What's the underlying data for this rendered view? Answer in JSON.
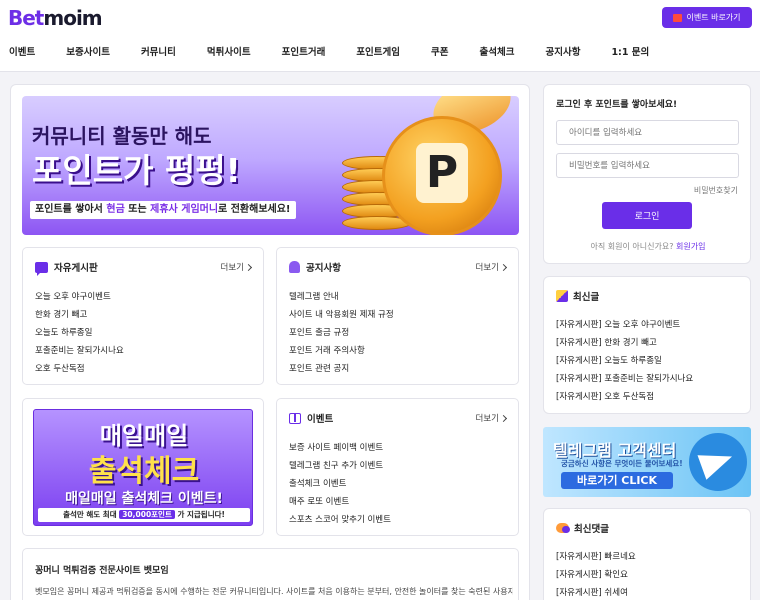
{
  "header": {
    "logo_a": "Bet",
    "logo_b": "moim",
    "event_button": "이벤트 바로가기"
  },
  "nav": [
    "이벤트",
    "보증사이트",
    "커뮤니티",
    "먹튀사이트",
    "포인트거래",
    "포인트게임",
    "쿠폰",
    "출석체크",
    "공지사항",
    "1:1 문의"
  ],
  "banner": {
    "line1": "커뮤니티 활동만 해도",
    "line2": "포인트가 펑펑!",
    "sub_pre": "포인트를 쌓아서 ",
    "sub_hl1": "현금",
    "sub_mid": " 또는 ",
    "sub_hl2": "제휴사 게임머니",
    "sub_post": "로 전환해보세요!",
    "coin_letter": "P"
  },
  "free_board": {
    "title": "자유게시판",
    "more": "더보기",
    "items": [
      "오늘 오후 야구이벤트",
      "한화 경기 빼고",
      "오늘도 하루종일",
      "포출준비는 잘되가시나요",
      "오호 두산독점"
    ]
  },
  "notice": {
    "title": "공지사항",
    "more": "더보기",
    "items": [
      "텔레그램 안내",
      "사이트 내 악용회원 제재 규정",
      "포인트 출금 규정",
      "포인트 거래 주의사항",
      "포인트 관련 공지"
    ]
  },
  "attendance_banner": {
    "line1": "매일매일",
    "line2": "출석체크",
    "line3": "매일매일 출석체크 이벤트!",
    "line4_pre": "출석만 해도 최대 ",
    "line4_pill": "30,000포인트",
    "line4_post": " 가 지급됩니다!"
  },
  "events": {
    "title": "이벤트",
    "more": "더보기",
    "items": [
      "보증 사이트 페이백 이벤트",
      "텔레그램 친구 추가 이벤트",
      "출석체크 이벤트",
      "매주 로또 이벤트",
      "스포츠 스코어 맞추기 이벤트"
    ]
  },
  "about": {
    "title": "꽁머니 먹튀검증 전문사이트 벳모임",
    "body": "벳모임은 꽁머니 제공과 먹튀검증을 동시에 수행하는 전문 커뮤니티입니다. 사이트를 처음 이용하는 분부터, 안전한 놀이터를 찾는 숙련된 사용자까지"
  },
  "login": {
    "title": "로그인 후 포인트를 쌓아보세요!",
    "id_placeholder": "아이디를 입력하세요",
    "pw_placeholder": "비밀번호를 입력하세요",
    "find_password": "비밀번호찾기",
    "login_button": "로그인",
    "not_member": "아직 회원이 아니신가요?",
    "signup": "회원가입"
  },
  "latest_posts": {
    "title": "최신글",
    "items": [
      "[자유게시판] 오늘 오후 야구이벤트",
      "[자유게시판] 한화 경기 빼고",
      "[자유게시판] 오늘도 하루종일",
      "[자유게시판] 포출준비는 잘되가시나요",
      "[자유게시판] 오호 두산독점"
    ]
  },
  "telegram_banner": {
    "line1": "텔레그램 고객센터",
    "line2": "궁금하신 사항은 무엇이든 물어보세요!",
    "button": "바로가기 CLICK"
  },
  "latest_comments": {
    "title": "최신댓글",
    "items": [
      "[자유게시판] 빠르네요",
      "[자유게시판] 확인요",
      "[자유게시판] 쉬세여"
    ]
  },
  "colors": {
    "accent": "#6a2ee8",
    "background": "#f3f3f7"
  }
}
